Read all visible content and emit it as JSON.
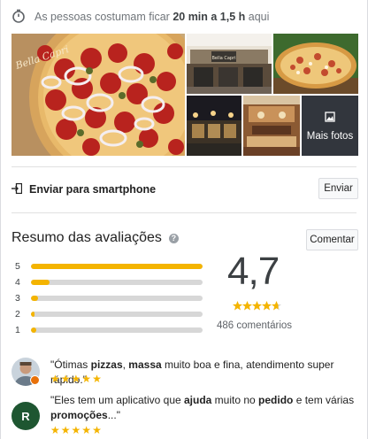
{
  "visit": {
    "icon": "stopwatch-icon",
    "prefix": "As pessoas costumam ficar ",
    "duration": "20 min a 1,5 h",
    "suffix": " aqui"
  },
  "photos": {
    "more_label": "Mais fotos",
    "store_sign": "Bella Capri"
  },
  "send": {
    "icon": "send-to-phone-icon",
    "label": "Enviar para smartphone",
    "button": "Enviar"
  },
  "reviews_summary": {
    "title": "Resumo das avaliações",
    "help_icon": "help-icon",
    "help_glyph": "?",
    "write_button": "Comentar",
    "rating": "4,7",
    "rating_value": 4.7,
    "review_count": "486 comentários",
    "distribution": [
      {
        "stars": "5",
        "fraction": 1.0
      },
      {
        "stars": "4",
        "fraction": 0.11
      },
      {
        "stars": "3",
        "fraction": 0.04
      },
      {
        "stars": "2",
        "fraction": 0.01
      },
      {
        "stars": "1",
        "fraction": 0.03
      }
    ],
    "star_color": "#f4b400"
  },
  "reviews": [
    {
      "avatar": "user-photo",
      "quote_open": "\"Ótimas ",
      "b1": "pizzas",
      "t1": ", ",
      "b2": "massa",
      "t2": " muito boa e fina, atendimento super rápido.\"",
      "stars": 5
    },
    {
      "avatar_letter": "R",
      "avatar_color": "#1e5631",
      "t0": "\"Eles tem um aplicativo que ",
      "b1": "ajuda",
      "t1": " muito no ",
      "b2": "pedido",
      "t2": " e tem várias ",
      "b3": "promoções",
      "t3": "...\"",
      "stars": 5
    }
  ]
}
